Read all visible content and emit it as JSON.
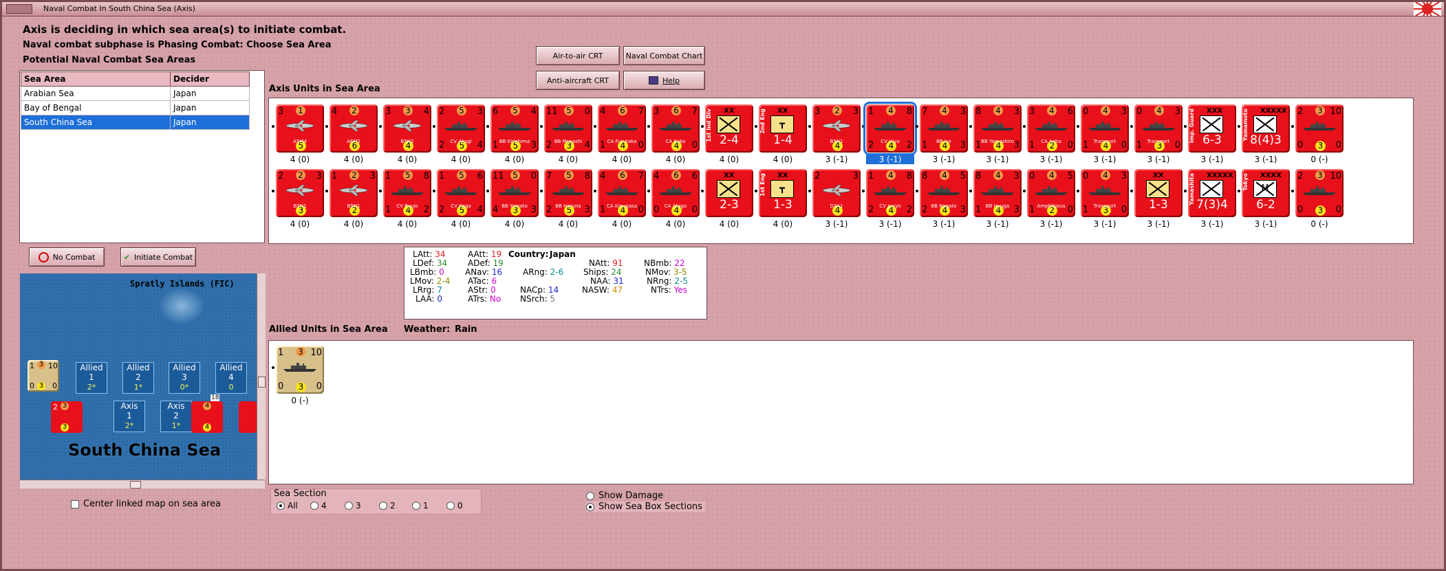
{
  "window": {
    "title": "Naval Combat In South China Sea (Axis)"
  },
  "status": {
    "line1": "Axis is deciding in which sea area(s) to initiate combat.",
    "line2": "Naval combat subphase is Phasing Combat: Choose Sea Area",
    "line3": "Potential Naval Combat Sea Areas"
  },
  "buttons": {
    "air_crt": "Air-to-air CRT",
    "naval_crt": "Naval Combat Chart",
    "aa_crt": "Anti-aircraft CRT",
    "help": "Help",
    "no_combat": "No Combat",
    "initiate": "Initiate Combat"
  },
  "sea_table": {
    "headers": [
      "Sea Area",
      "Decider"
    ],
    "rows": [
      {
        "area": "Arabian Sea",
        "decider": "Japan"
      },
      {
        "area": "Bay of Bengal",
        "decider": "Japan"
      },
      {
        "area": "South China Sea",
        "decider": "Japan"
      }
    ]
  },
  "labels": {
    "axis_units": "Axis Units in Sea Area",
    "allied_units": "Allied Units in Sea Area",
    "weather_label": "Weather:",
    "weather_value": "Rain",
    "center_map": "Center linked map on sea area",
    "sea_section": "Sea Section",
    "show_damage": "Show Damage",
    "show_boxes": "Show Sea Box Sections"
  },
  "sea_sections": [
    "All",
    "4",
    "3",
    "2",
    "1",
    "0"
  ],
  "stats": {
    "LAtt": "34",
    "LDef": "34",
    "LBmb": "0",
    "LMov": "2-4",
    "LRrg": "7",
    "LAA": "0",
    "AAtt": "19",
    "ADef": "19",
    "ANav": "16",
    "ATac": "6",
    "AStr": "0",
    "ATrs": "No",
    "country_label": "Country:",
    "country": "Japan",
    "ARng": "2-6",
    "NACp": "14",
    "NSrch": "5",
    "NAtt": "91",
    "Ships": "24",
    "NAA": "31",
    "NASW": "47",
    "NBmb": "22",
    "NMov": "3-5",
    "NRng": "2-5",
    "NTrs": "Yes"
  },
  "axis_units": [
    {
      "kind": "air",
      "tl": "3",
      "tm": "1",
      "tr": "",
      "bl": "",
      "bm": "5",
      "br": "",
      "name": "A5M4",
      "sub": "4 (0)"
    },
    {
      "kind": "air",
      "tl": "4",
      "tm": "2",
      "tr": "",
      "bl": "",
      "bm": "6",
      "br": "",
      "name": "A6M2",
      "sub": "4 (0)"
    },
    {
      "kind": "air",
      "tl": "3",
      "tm": "3",
      "tr": "4",
      "bl": "",
      "bm": "4",
      "br": "",
      "name": "B5N2",
      "sub": "4 (0)"
    },
    {
      "kind": "ship",
      "tl": "2",
      "tm": "5",
      "tr": "3",
      "bl": "2",
      "bm": "5",
      "br": "4",
      "name": "CV Akagi",
      "sub": "4 (0)"
    },
    {
      "kind": "ship",
      "tl": "6",
      "tm": "5",
      "tr": "4",
      "bl": "1",
      "bm": "5",
      "br": "3",
      "name": "BB Kirishima",
      "sub": "4 (0)"
    },
    {
      "kind": "ship",
      "tl": "11",
      "tm": "5",
      "tr": "0",
      "bl": "2",
      "bm": "3",
      "br": "4",
      "name": "BB Musashi",
      "sub": "4 (0)"
    },
    {
      "kind": "ship",
      "tl": "4",
      "tm": "6",
      "tr": "7",
      "bl": "1",
      "bm": "4",
      "br": "0",
      "name": "CA Furutaka",
      "sub": "4 (0)"
    },
    {
      "kind": "ship",
      "tl": "3",
      "tm": "6",
      "tr": "7",
      "bl": "",
      "bm": "4",
      "br": "0",
      "name": "CA Kako",
      "sub": "4 (0)"
    },
    {
      "kind": "inf",
      "size": "XX",
      "vname": "1st Ind Div",
      "strength": "2-4",
      "sub": "4 (0)"
    },
    {
      "kind": "eng",
      "size": "XX",
      "vname": "2nd Eng",
      "strength": "1-4",
      "sub": "4 (0)"
    },
    {
      "kind": "air",
      "tl": "3",
      "tm": "2",
      "tr": "3",
      "bl": "",
      "bm": "4",
      "br": "",
      "name": "B5N1",
      "sub": "3 (-1)"
    },
    {
      "kind": "ship",
      "tl": "1",
      "tm": "4",
      "tr": "8",
      "bl": "2",
      "bm": "4",
      "br": "2",
      "name": "CV Hiyo",
      "sub": "3 (-1)",
      "selected": true
    },
    {
      "kind": "ship",
      "tl": "7",
      "tm": "4",
      "tr": "3",
      "bl": "1",
      "bm": "4",
      "br": "3",
      "name": "BB Ise",
      "sub": "3 (-1)"
    },
    {
      "kind": "ship",
      "tl": "8",
      "tm": "4",
      "tr": "3",
      "bl": "1",
      "bm": "4",
      "br": "3",
      "name": "BB Yamashiro",
      "sub": "3 (-1)"
    },
    {
      "kind": "ship",
      "tl": "3",
      "tm": "4",
      "tr": "6",
      "bl": "1",
      "bm": "2",
      "br": "0",
      "name": "CA Aoba",
      "sub": "3 (-1)"
    },
    {
      "kind": "ship",
      "tl": "0",
      "tm": "4",
      "tr": "3",
      "bl": "1",
      "bm": "4",
      "br": "0",
      "name": "Transport",
      "sub": "3 (-1)"
    },
    {
      "kind": "ship",
      "tl": "0",
      "tm": "4",
      "tr": "3",
      "bl": "1",
      "bm": "3",
      "br": "0",
      "name": "Transport",
      "sub": "3 (-1)"
    },
    {
      "kind": "hq",
      "size": "XXX",
      "vname": "Imp. Guard",
      "strength": "6-3",
      "sub": "3 (-1)"
    },
    {
      "kind": "hq",
      "size": "XXXXX",
      "vname": "Yamamoto",
      "strength": "8(4)3",
      "sub": "3 (-1)"
    },
    {
      "kind": "ship",
      "tl": "2",
      "tm": "3",
      "tr": "10",
      "bl": "0",
      "bm": "3",
      "br": "0",
      "name": "",
      "sub": "0 (-)"
    },
    {
      "kind": "air",
      "tl": "2",
      "tm": "2",
      "tr": "3",
      "bl": "",
      "bm": "3",
      "br": "",
      "name": "B5N1",
      "sub": "4 (0)"
    },
    {
      "kind": "air",
      "tl": "1",
      "tm": "2",
      "tr": "3",
      "bl": "",
      "bm": "2",
      "br": "",
      "name": "B5N1",
      "sub": "4 (0)"
    },
    {
      "kind": "ship",
      "tl": "1",
      "tm": "5",
      "tr": "8",
      "bl": "1",
      "bm": "4",
      "br": "2",
      "name": "CV Ryujo",
      "sub": "4 (0)"
    },
    {
      "kind": "ship",
      "tl": "1",
      "tm": "5",
      "tr": "6",
      "bl": "2",
      "bm": "5",
      "br": "4",
      "name": "CV Kaga",
      "sub": "4 (0)"
    },
    {
      "kind": "ship",
      "tl": "11",
      "tm": "5",
      "tr": "0",
      "bl": "4",
      "bm": "3",
      "br": "3",
      "name": "BB Yamato",
      "sub": "4 (0)"
    },
    {
      "kind": "ship",
      "tl": "7",
      "tm": "5",
      "tr": "8",
      "bl": "2",
      "bm": "5",
      "br": "3",
      "name": "BB Haruna",
      "sub": "4 (0)"
    },
    {
      "kind": "ship",
      "tl": "4",
      "tm": "6",
      "tr": "7",
      "bl": "1",
      "bm": "4",
      "br": "0",
      "name": "CA Kinugasa",
      "sub": "4 (0)"
    },
    {
      "kind": "ship",
      "tl": "4",
      "tm": "6",
      "tr": "6",
      "bl": "0",
      "bm": "4",
      "br": "0",
      "name": "CA Atago",
      "sub": "4 (0)"
    },
    {
      "kind": "inf",
      "size": "XX",
      "vname": "",
      "strength": "2-3",
      "sub": "4 (0)"
    },
    {
      "kind": "eng",
      "size": "XX",
      "vname": "1st Eng",
      "strength": "1-3",
      "sub": "4 (0)"
    },
    {
      "kind": "air",
      "tl": "2",
      "tm": "",
      "tr": "3",
      "bl": "",
      "bm": "4",
      "br": "",
      "name": "D3A1",
      "sub": "3 (-1)"
    },
    {
      "kind": "ship",
      "tl": "1",
      "tm": "4",
      "tr": "8",
      "bl": "2",
      "bm": "4",
      "br": "2",
      "name": "CV Junyo",
      "sub": "3 (-1)"
    },
    {
      "kind": "ship",
      "tl": "8",
      "tm": "4",
      "tr": "5",
      "bl": "2",
      "bm": "4",
      "br": "3",
      "name": "BB Nagato",
      "sub": "3 (-1)"
    },
    {
      "kind": "ship",
      "tl": "8",
      "tm": "4",
      "tr": "3",
      "bl": "1",
      "bm": "4",
      "br": "3",
      "name": "BB Hyuga",
      "sub": "3 (-1)"
    },
    {
      "kind": "ship",
      "tl": "0",
      "tm": "4",
      "tr": "5",
      "bl": "1",
      "bm": "2",
      "br": "0",
      "name": "Amphibious",
      "sub": "3 (-1)"
    },
    {
      "kind": "ship",
      "tl": "0",
      "tm": "4",
      "tr": "3",
      "bl": "1",
      "bm": "3",
      "br": "0",
      "name": "Transport",
      "sub": "3 (-1)"
    },
    {
      "kind": "inf",
      "size": "XX",
      "vname": "",
      "strength": "1-3",
      "sub": "3 (-1)"
    },
    {
      "kind": "hq",
      "size": "XXXXX",
      "vname": "Yamashita",
      "strength": "7(3)4",
      "sub": "3 (-1)"
    },
    {
      "kind": "hqm",
      "size": "XXXX",
      "vname": "Tokyo",
      "strength": "6-2",
      "sub": "3 (-1)"
    },
    {
      "kind": "ship",
      "tl": "2",
      "tm": "3",
      "tr": "10",
      "bl": "0",
      "bm": "3",
      "br": "0",
      "name": "",
      "sub": "0 (-)"
    }
  ],
  "allied_units": [
    {
      "kind": "ship",
      "tl": "1",
      "tm": "3",
      "tr": "10",
      "bl": "0",
      "bm": "3",
      "br": "0",
      "name": "",
      "sub": "0 (-)"
    }
  ],
  "map": {
    "title": "South China Sea",
    "island": "Spratly Islands (FIC)",
    "boxes": [
      {
        "side": "Allied",
        "num": "1",
        "val": "2*"
      },
      {
        "side": "Allied",
        "num": "2",
        "val": "1*"
      },
      {
        "side": "Allied",
        "num": "3",
        "val": "0*"
      },
      {
        "side": "Allied",
        "num": "4",
        "val": "0"
      },
      {
        "side": "Axis",
        "num": "1",
        "val": "2*"
      },
      {
        "side": "Axis",
        "num": "2",
        "val": "1*"
      }
    ],
    "stack_count": "18"
  }
}
